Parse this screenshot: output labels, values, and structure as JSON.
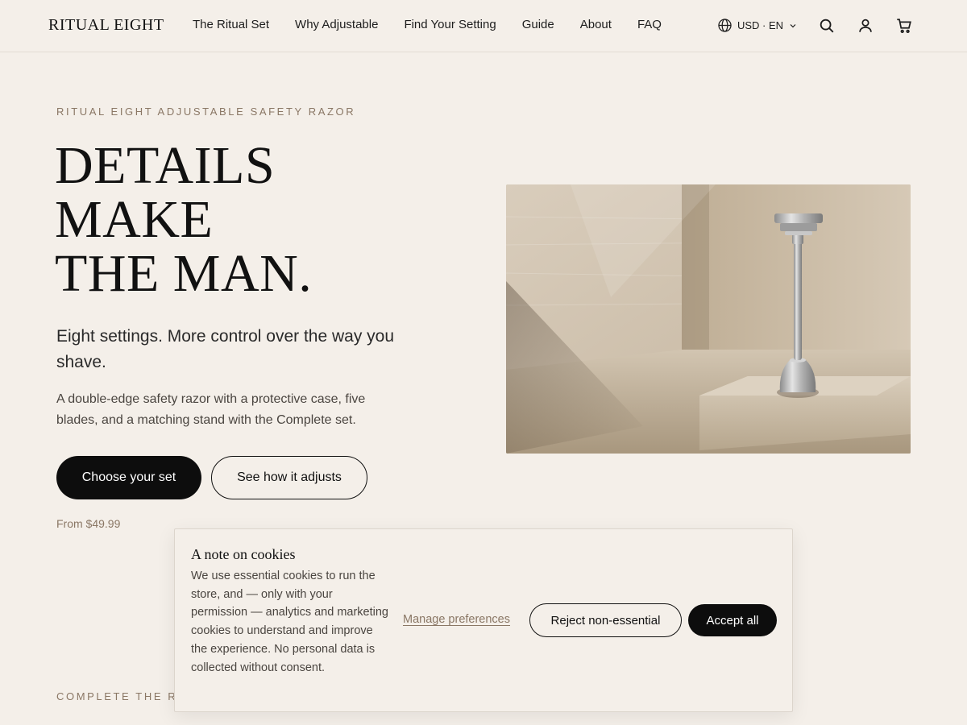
{
  "header": {
    "logo": "RITUAL EIGHT",
    "nav": [
      {
        "label": "The Ritual Set"
      },
      {
        "label": "Why Adjustable"
      },
      {
        "label": "Find Your Setting"
      },
      {
        "label": "Guide"
      },
      {
        "label": "About"
      },
      {
        "label": "FAQ"
      }
    ],
    "locale": "USD · EN",
    "icons": [
      "globe-icon",
      "chevron-down-icon",
      "search-icon",
      "account-icon",
      "cart-icon"
    ]
  },
  "hero": {
    "eyebrow": "RITUAL EIGHT ADJUSTABLE SAFETY RAZOR",
    "headline": [
      "DETAILS",
      "MAKE",
      "THE MAN."
    ],
    "lead": "Eight settings. More control over the way you shave.",
    "body": "A double-edge safety razor with a protective case, five blades, and a matching stand with the Complete set.",
    "primary_cta": "Choose your set",
    "secondary_cta": "See how it adjusts",
    "price": "From $49.99"
  },
  "next_section": {
    "eyebrow": "COMPLETE THE RI"
  },
  "cookie_banner": {
    "title": "A note on cookies",
    "text": "We use essential cookies to run the store, and — only with your permission — analytics and marketing cookies to understand and improve the experience. No personal data is collected without consent.",
    "manage": "Manage preferences",
    "reject": "Reject non-essential",
    "accept": "Accept all"
  },
  "colors": {
    "background": "#f4efe9",
    "primary_button": "#0d0d0d",
    "accent_text": "#8a7765"
  }
}
